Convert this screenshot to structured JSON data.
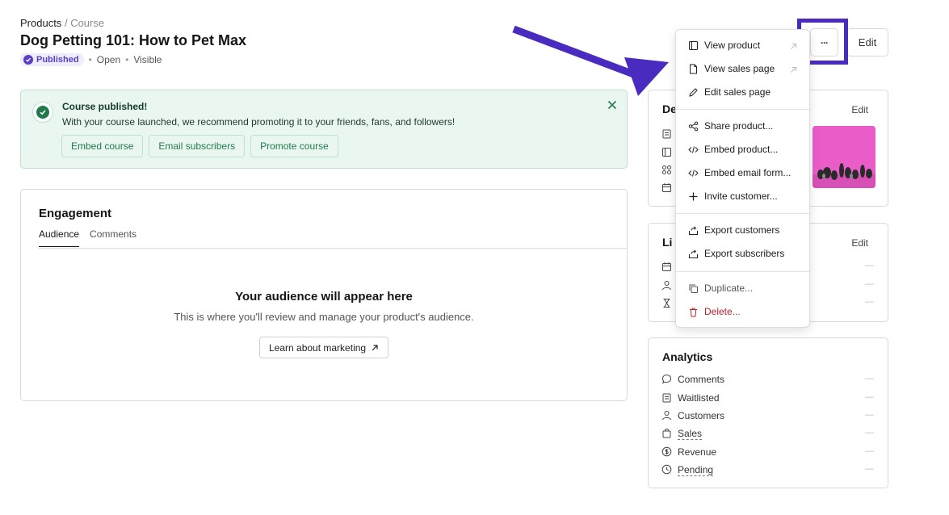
{
  "breadcrumb": {
    "root": "Products",
    "separator": "/",
    "current": "Course"
  },
  "page": {
    "title": "Dog Petting 101: How to Pet Max"
  },
  "status": {
    "published": "Published",
    "open": "Open",
    "visible": "Visible",
    "dot": "•"
  },
  "banner": {
    "title": "Course published!",
    "text": "With your course launched, we recommend promoting it to your friends, fans, and followers!",
    "actions": [
      "Embed course",
      "Email subscribers",
      "Promote course"
    ]
  },
  "engagement": {
    "title": "Engagement",
    "tabs": [
      "Audience",
      "Comments"
    ],
    "empty_title": "Your audience will appear here",
    "empty_text": "This is where you'll review and manage your product's audience.",
    "learn_label": "Learn about marketing"
  },
  "header": {
    "edit_label": "Edit",
    "more_label": "···"
  },
  "details": {
    "title_partial": "De",
    "edit_label": "Edit"
  },
  "limits": {
    "title_partial": "Li",
    "edit_label": "Edit",
    "dashes": [
      "—",
      "—",
      "—"
    ]
  },
  "analytics": {
    "title": "Analytics",
    "rows": [
      {
        "label": "Comments",
        "value": "—",
        "icon": "comment-icon"
      },
      {
        "label": "Waitlisted",
        "value": "—",
        "icon": "clipboard-icon"
      },
      {
        "label": "Customers",
        "value": "—",
        "icon": "user-icon"
      },
      {
        "label": "Sales",
        "value": "—",
        "icon": "bag-icon"
      },
      {
        "label": "Revenue",
        "value": "—",
        "icon": "dollar-icon"
      },
      {
        "label": "Pending",
        "value": "—",
        "icon": "clock-icon"
      }
    ]
  },
  "menu": {
    "items": [
      {
        "label": "View product",
        "icon": "panel-icon"
      },
      {
        "label": "View sales page",
        "icon": "file-icon"
      },
      {
        "label": "Edit sales page",
        "icon": "pencil-icon"
      },
      {
        "label": "Share product...",
        "icon": "share-icon"
      },
      {
        "label": "Embed product...",
        "icon": "code-icon"
      },
      {
        "label": "Embed email form...",
        "icon": "code-icon"
      },
      {
        "label": "Invite customer...",
        "icon": "plus-icon"
      },
      {
        "label": "Export customers",
        "icon": "export-icon"
      },
      {
        "label": "Export subscribers",
        "icon": "export-icon"
      },
      {
        "label": "Duplicate...",
        "icon": "copy-icon"
      },
      {
        "label": "Delete...",
        "icon": "trash-icon"
      }
    ]
  },
  "colors": {
    "accent": "#4a2bc0",
    "success": "#1f7a4c",
    "danger": "#c0242a",
    "badge": "#5b3fc4"
  }
}
